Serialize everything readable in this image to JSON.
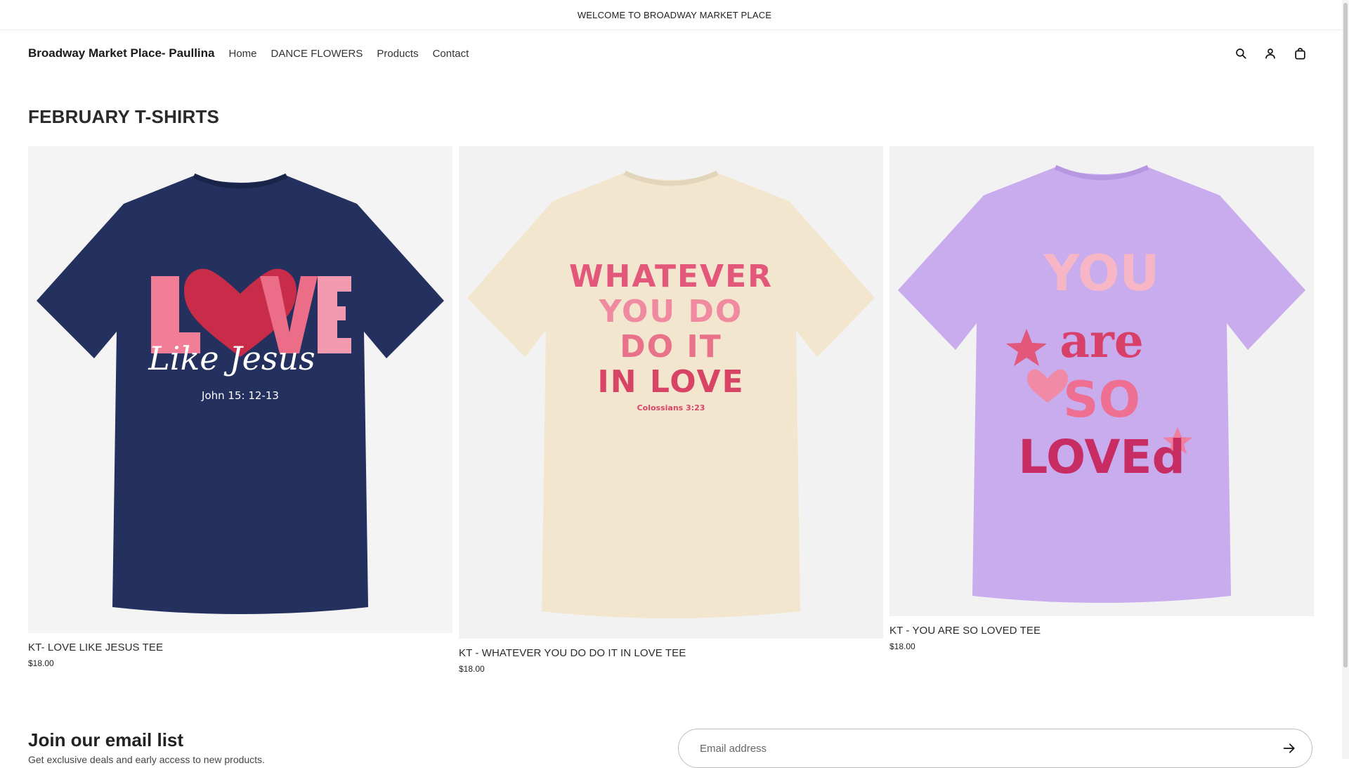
{
  "announcement": {
    "text": "WELCOME TO BROADWAY MARKET PLACE"
  },
  "header": {
    "brand": "Broadway Market Place- Paullina",
    "nav": [
      "Home",
      "DANCE FLOWERS",
      "Products",
      "Contact"
    ],
    "icons": [
      "search-icon",
      "account-icon",
      "cart-icon"
    ]
  },
  "collection": {
    "title": "FEBRUARY T-SHIRTS",
    "products": [
      {
        "title": "KT- LOVE LIKE JESUS TEE",
        "price": "$18.00",
        "shirt_color": "#24305e",
        "print": {
          "line1": "LOVE",
          "script": "Like Jesus",
          "ref": "John 15: 12-13"
        }
      },
      {
        "title": "KT - WHATEVER YOU DO DO IT IN LOVE TEE",
        "price": "$18.00",
        "shirt_color": "#f3e6cf",
        "print": {
          "lines": [
            "WHATEVER",
            "YOU DO",
            "DO IT",
            "IN LOVE"
          ],
          "ref": "Colossians 3:23"
        }
      },
      {
        "title": "KT - YOU ARE SO LOVED TEE",
        "price": "$18.00",
        "shirt_color": "#c9acee",
        "print": {
          "lines": [
            "YOU",
            "are",
            "SO",
            "LOVEd"
          ]
        }
      }
    ]
  },
  "newsletter": {
    "heading": "Join our email list",
    "subtext": "Get exclusive deals and early access to new products.",
    "placeholder": "Email address"
  },
  "colors": {
    "accent_pink": "#e2577a",
    "text": "#1f1f1f",
    "border": "#bdbdbd"
  }
}
